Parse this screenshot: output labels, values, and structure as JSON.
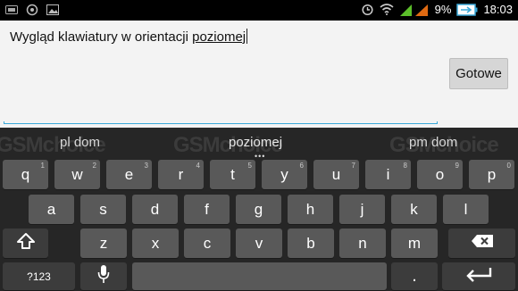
{
  "status_bar": {
    "battery_percent": "9%",
    "time": "18:03"
  },
  "editor": {
    "text_prefix": "Wygląd klawiatury w orientacji ",
    "composing_word": "poziomej",
    "done_button_label": "Gotowe"
  },
  "keyboard": {
    "watermark": "GSMchoice",
    "suggestions": [
      "pl dom",
      "poziomej",
      "pm dom"
    ],
    "suggestions_more": "•••",
    "row1": [
      {
        "label": "q",
        "hint": "1"
      },
      {
        "label": "w",
        "hint": "2"
      },
      {
        "label": "e",
        "hint": "3"
      },
      {
        "label": "r",
        "hint": "4"
      },
      {
        "label": "t",
        "hint": "5"
      },
      {
        "label": "y",
        "hint": "6"
      },
      {
        "label": "u",
        "hint": "7"
      },
      {
        "label": "i",
        "hint": "8"
      },
      {
        "label": "o",
        "hint": "9"
      },
      {
        "label": "p",
        "hint": "0"
      }
    ],
    "row2": [
      "a",
      "s",
      "d",
      "f",
      "g",
      "h",
      "j",
      "k",
      "l"
    ],
    "row3": [
      "z",
      "x",
      "c",
      "v",
      "b",
      "n",
      "m"
    ],
    "symbols_label": "?123",
    "period_label": "."
  },
  "icons": [
    "sim-icon",
    "whatsapp-icon",
    "gallery-icon",
    "alarm-icon",
    "wifi-icon",
    "signal-icon",
    "battery-icon",
    "shift-icon",
    "backspace-icon",
    "mic-icon",
    "enter-icon"
  ],
  "colors": {
    "accent": "#3aa8d8",
    "key": "#595959",
    "keyboard_bg": "#262626",
    "status_bg": "#000000"
  }
}
